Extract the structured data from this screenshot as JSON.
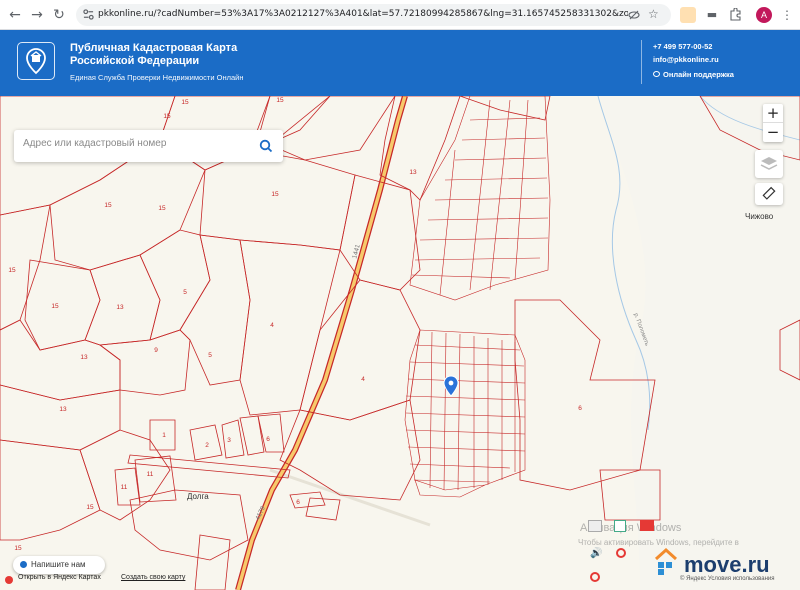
{
  "browser": {
    "url": "pkkonline.ru/?cadNumber=53%3A17%3A0212127%3A401&lat=57.72180994285867&lng=31.165745258331302&zoom=16",
    "avatar_letter": "A",
    "back_icon": "←",
    "forward_icon": "→",
    "reload_icon": "↻",
    "close_tab_icon": "×"
  },
  "header": {
    "title_line1": "Публичная Кадастровая Карта",
    "title_line2": "Российской Федерации",
    "subtitle": "Единая Служба Проверки Недвижимости Онлайн",
    "phone": "+7 499 577-00-52",
    "email": "info@pkkonline.ru",
    "support": "Онлайн поддержка",
    "brand_color": "#1b6cc6"
  },
  "search": {
    "placeholder": "Адрес или кадастровый номер"
  },
  "controls": {
    "zoom_in": "+",
    "zoom_out": "−"
  },
  "map_labels": {
    "village_chizhovo": "Чижово",
    "village_dolga": "Долга",
    "road_top": "1441",
    "road_bottom": "4179",
    "river": "р. Полометь",
    "left_plots": [
      "15",
      "15",
      "15",
      "15",
      "15",
      "13",
      "15",
      "13",
      "15",
      "15",
      "15",
      "15",
      "15",
      "13",
      "5",
      "5",
      "9",
      "4",
      "4",
      "4",
      "1",
      "3",
      "2",
      "6",
      "11",
      "11",
      "13",
      "6"
    ]
  },
  "chat": {
    "label": "Напишите нам"
  },
  "footer": {
    "link1": "Открыть в Яндекс Картах",
    "link2": "Создать свою карту",
    "yandex_terms": "© Яндекс Условия использования"
  },
  "watermark": {
    "line1": "Активация Windows",
    "line2": "Чтобы активировать Windows, перейдите в"
  },
  "brand_watermark": "move.ru"
}
